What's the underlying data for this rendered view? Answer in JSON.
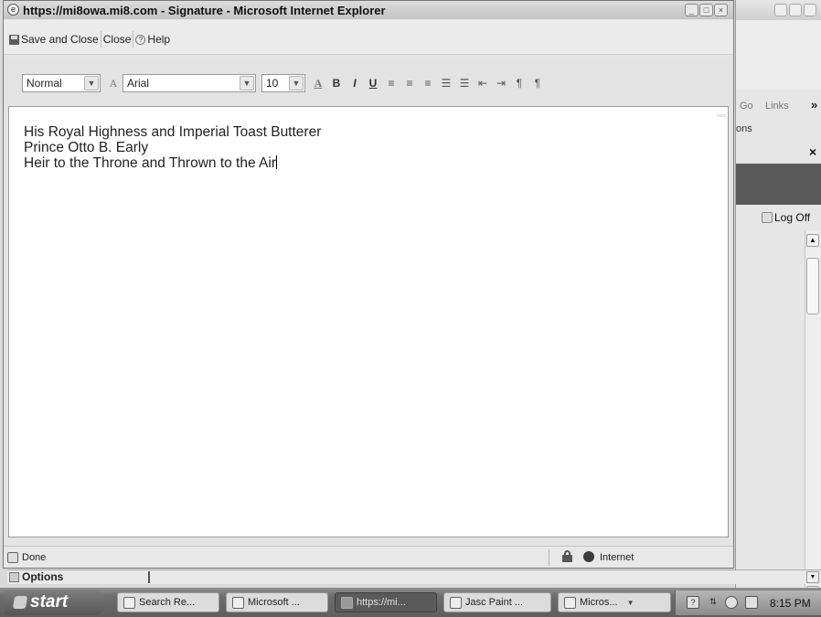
{
  "ie_window": {
    "title": "https://mi8owa.mi8.com - Signature - Microsoft Internet Explorer"
  },
  "command_bar": {
    "save_and_close": "Save and Close",
    "close": "Close",
    "help": "Help"
  },
  "format_bar": {
    "style_value": "Normal",
    "font_value": "Arial",
    "size_value": "10",
    "font_icon_glyph": "A",
    "font_color_glyph": "A",
    "bold_glyph": "B",
    "italic_glyph": "I",
    "underline_glyph": "U"
  },
  "editor": {
    "lines": [
      "His Royal Highness and Imperial Toast Butterer",
      "Prince Otto B. Early",
      "Heir to the Throne and Thrown to the Air"
    ]
  },
  "status_bar": {
    "status": "Done",
    "zone": "Internet"
  },
  "background_window": {
    "go": "Go",
    "links": "Links",
    "chevron": "»",
    "options_fragment": "ons",
    "close_x": "×",
    "log_off": "Log Off"
  },
  "options_strip": {
    "label": "Options"
  },
  "taskbar": {
    "start": "start",
    "items": [
      {
        "label": "Search Re..."
      },
      {
        "label": "Microsoft ..."
      },
      {
        "label": "https://mi..."
      },
      {
        "label": "Jasc Paint ..."
      },
      {
        "label": "Micros..."
      }
    ],
    "clock": "8:15 PM"
  }
}
